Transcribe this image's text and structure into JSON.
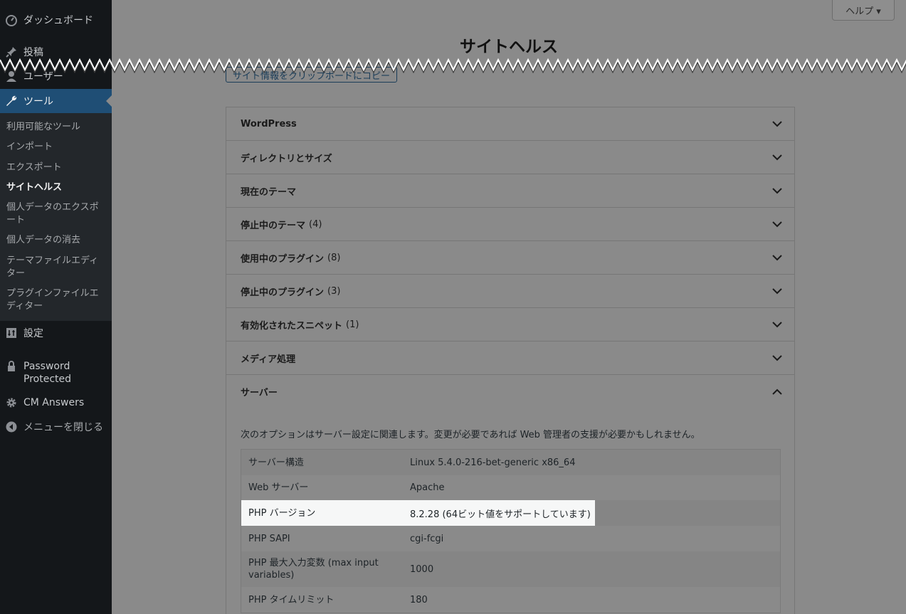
{
  "sidebar": {
    "items": [
      {
        "label": "ダッシュボード",
        "icon": "dashboard-icon"
      },
      {
        "label": "投稿",
        "icon": "pin-icon"
      },
      {
        "label": "ユーザー",
        "icon": "user-icon"
      },
      {
        "label": "ツール",
        "icon": "wrench-icon"
      }
    ],
    "submenu": [
      "利用可能なツール",
      "インポート",
      "エクスポート",
      "サイトヘルス",
      "個人データのエクスポート",
      "個人データの消去",
      "テーマファイルエディター",
      "プラグインファイルエディター"
    ],
    "settings": {
      "label": "設定",
      "icon": "settings-icon"
    },
    "password_protected": {
      "label": "Password Protected",
      "icon": "lock-icon"
    },
    "cm_answers": {
      "label": "CM Answers",
      "icon": "gear-icon"
    },
    "collapse": {
      "label": "メニューを閉じる",
      "icon": "collapse-icon"
    }
  },
  "header": {
    "help_label": "ヘルプ ▾",
    "title": "サイトヘルス",
    "copy_button": "サイト情報をクリップボードにコピー"
  },
  "accordion": [
    {
      "label": "WordPress",
      "count": ""
    },
    {
      "label": "ディレクトリとサイズ",
      "count": ""
    },
    {
      "label": "現在のテーマ",
      "count": ""
    },
    {
      "label": "停止中のテーマ",
      "count": "(4)"
    },
    {
      "label": "使用中のプラグイン",
      "count": "(8)"
    },
    {
      "label": "停止中のプラグイン",
      "count": "(3)"
    },
    {
      "label": "有効化されたスニペット",
      "count": "(1)"
    },
    {
      "label": "メディア処理",
      "count": ""
    },
    {
      "label": "サーバー",
      "count": ""
    }
  ],
  "server": {
    "description": "次のオプションはサーバー設定に関連します。変更が必要であれば Web 管理者の支援が必要かもしれません。",
    "rows": [
      {
        "key": "サーバー構造",
        "value": "Linux 5.4.0-216-bet-generic x86_64"
      },
      {
        "key": "Web サーバー",
        "value": "Apache"
      },
      {
        "key": "PHP バージョン",
        "value": "8.2.28 (64ビット値をサポートしています)"
      },
      {
        "key": "PHP SAPI",
        "value": "cgi-fcgi"
      },
      {
        "key": "PHP 最大入力変数 (max input variables)",
        "value": "1000"
      },
      {
        "key": "PHP タイムリミット",
        "value": "180"
      }
    ]
  },
  "colors": {
    "sidebar_bg": "#14171a",
    "active_menu": "#1f4e75",
    "overlay": "#8a8a8a",
    "highlight": "#f6f7f7"
  }
}
